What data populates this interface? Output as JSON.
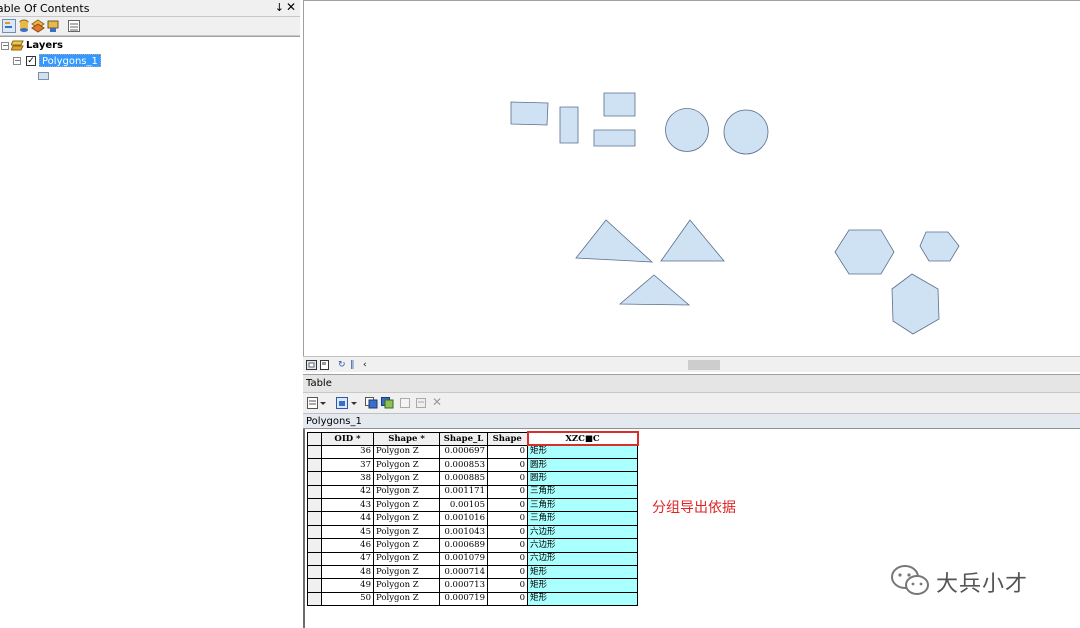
{
  "toc": {
    "title": "Table Of Contents",
    "pin_glyph": "↓",
    "close_glyph": "✕",
    "toolbar_icons": [
      "list-by-drawing-order-icon",
      "list-by-source-icon",
      "list-by-visibility-icon",
      "list-by-selection-icon",
      "options-icon"
    ],
    "root_label": "Layers",
    "layer_label": "Polygons_1",
    "expander_glyph": "−",
    "check_glyph": "✓"
  },
  "map": {
    "fill_color": "#cfe2f3",
    "stroke_color": "#5a6e8a",
    "bar_icons": [
      "data-view-icon",
      "layout-view-icon",
      "refresh-icon",
      "pause-icon",
      "scroll-left-icon"
    ]
  },
  "table_window": {
    "title": "Table",
    "tab_label": "Polygons_1",
    "toolbar_icons": [
      "table-options-icon",
      "related-tables-icon",
      "select-by-attributes-icon",
      "switch-selection-icon",
      "clear-selection-icon",
      "zoom-to-selected-icon",
      "delete-selected-icon"
    ],
    "columns": [
      "OID *",
      "Shape *",
      "Shape_L",
      "Shape",
      "XZC■C"
    ],
    "rows": [
      {
        "oid": "36",
        "shape": "Polygon Z",
        "shape_l": "0.000697",
        "shape_v": "0",
        "xzcmc": "矩形"
      },
      {
        "oid": "37",
        "shape": "Polygon Z",
        "shape_l": "0.000853",
        "shape_v": "0",
        "xzcmc": "圆形"
      },
      {
        "oid": "38",
        "shape": "Polygon Z",
        "shape_l": "0.000885",
        "shape_v": "0",
        "xzcmc": "圆形"
      },
      {
        "oid": "42",
        "shape": "Polygon Z",
        "shape_l": "0.001171",
        "shape_v": "0",
        "xzcmc": "三角形"
      },
      {
        "oid": "43",
        "shape": "Polygon Z",
        "shape_l": "0.00105",
        "shape_v": "0",
        "xzcmc": "三角形"
      },
      {
        "oid": "44",
        "shape": "Polygon Z",
        "shape_l": "0.001016",
        "shape_v": "0",
        "xzcmc": "三角形"
      },
      {
        "oid": "45",
        "shape": "Polygon Z",
        "shape_l": "0.001043",
        "shape_v": "0",
        "xzcmc": "六边形"
      },
      {
        "oid": "46",
        "shape": "Polygon Z",
        "shape_l": "0.000689",
        "shape_v": "0",
        "xzcmc": "六边形"
      },
      {
        "oid": "47",
        "shape": "Polygon Z",
        "shape_l": "0.001079",
        "shape_v": "0",
        "xzcmc": "六边形"
      },
      {
        "oid": "48",
        "shape": "Polygon Z",
        "shape_l": "0.000714",
        "shape_v": "0",
        "xzcmc": "矩形"
      },
      {
        "oid": "49",
        "shape": "Polygon Z",
        "shape_l": "0.000713",
        "shape_v": "0",
        "xzcmc": "矩形"
      },
      {
        "oid": "50",
        "shape": "Polygon Z",
        "shape_l": "0.000719",
        "shape_v": "0",
        "xzcmc": "矩形"
      }
    ],
    "highlight_color": "#aaffff",
    "annotation": "分组导出依据",
    "annotation_color": "#e02424"
  },
  "watermark": {
    "text": "大兵小才",
    "icon": "wechat-icon"
  }
}
